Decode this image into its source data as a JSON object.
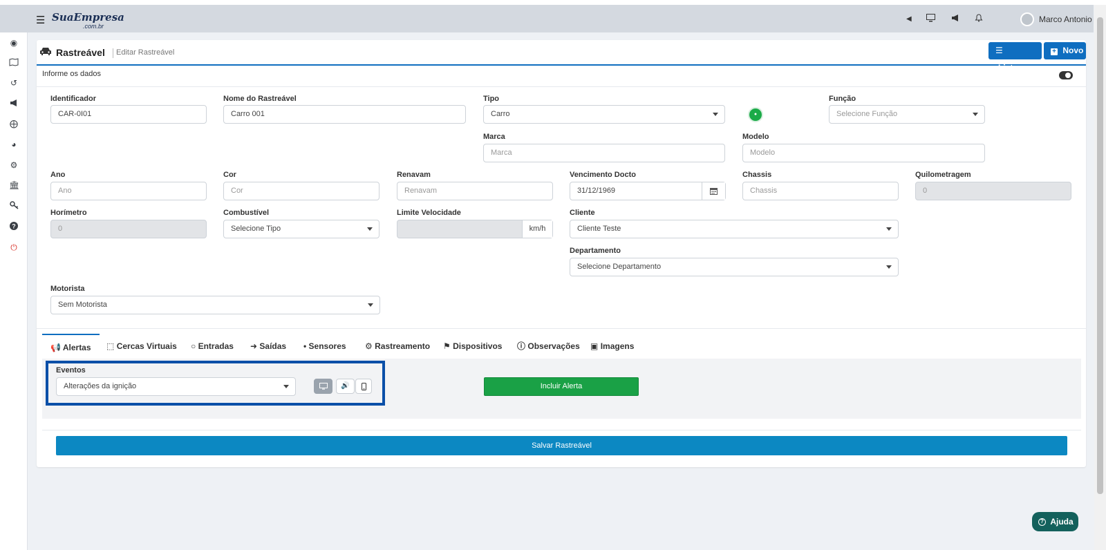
{
  "topbar": {
    "logo": "SuaEmpresa",
    "logo_sub": ".com.br",
    "username": "Marco Antonio",
    "icons": [
      "caret-left-icon",
      "monitor-icon",
      "megaphone-icon",
      "bell-icon"
    ]
  },
  "sidebar": {
    "icons": [
      "dashboard-icon",
      "map-icon",
      "history-icon",
      "megaphone-icon",
      "crosshair-icon",
      "pie-chart-icon",
      "gears-icon",
      "bank-icon",
      "key-icon",
      "help-icon",
      "power-icon"
    ]
  },
  "header": {
    "title": "Rastreável",
    "subtitle": "Editar Rastreável",
    "btn_list": "Listagem",
    "btn_new": "Novo"
  },
  "section": {
    "label": "Informe os dados"
  },
  "form": {
    "identificador": {
      "label": "Identificador",
      "value": "CAR-0I01"
    },
    "nome": {
      "label": "Nome do Rastreável",
      "value": "Carro 001"
    },
    "tipo": {
      "label": "Tipo",
      "value": "Carro"
    },
    "funcao": {
      "label": "Função",
      "value": "Selecione Função"
    },
    "marca": {
      "label": "Marca",
      "placeholder": "Marca"
    },
    "modelo": {
      "label": "Modelo",
      "placeholder": "Modelo"
    },
    "ano": {
      "label": "Ano",
      "placeholder": "Ano"
    },
    "cor": {
      "label": "Cor",
      "placeholder": "Cor"
    },
    "renavam": {
      "label": "Renavam",
      "placeholder": "Renavam"
    },
    "vencimento": {
      "label": "Vencimento Docto",
      "value": "31/12/1969"
    },
    "chassis": {
      "label": "Chassis",
      "placeholder": "Chassis"
    },
    "quilometragem": {
      "label": "Quilometragem",
      "value": "0"
    },
    "horimetro": {
      "label": "Horímetro",
      "value": "0"
    },
    "combustivel": {
      "label": "Combustível",
      "value": "Selecione Tipo"
    },
    "limite": {
      "label": "Limite Velocidade",
      "value": "",
      "unit": "km/h"
    },
    "cliente": {
      "label": "Cliente",
      "value": "Cliente Teste"
    },
    "departamento": {
      "label": "Departamento",
      "value": "Selecione Departamento"
    },
    "motorista": {
      "label": "Motorista",
      "value": "Sem Motorista"
    }
  },
  "tabs": [
    {
      "label": "Alertas"
    },
    {
      "label": "Cercas Virtuais"
    },
    {
      "label": "Entradas"
    },
    {
      "label": "Saídas"
    },
    {
      "label": "Sensores"
    },
    {
      "label": "Rastreamento"
    },
    {
      "label": "Dispositivos"
    },
    {
      "label": "Observações"
    },
    {
      "label": "Imagens"
    }
  ],
  "alerts": {
    "eventos_label": "Eventos",
    "eventos_value": "Alterações da ignição",
    "include_button": "Incluir Alerta"
  },
  "save_button": "Salvar Rastreável",
  "help_button": "Ajuda",
  "colors": {
    "primary": "#0f6ec0",
    "success": "#1aa146",
    "save": "#0c88c2",
    "help": "#13615c"
  }
}
